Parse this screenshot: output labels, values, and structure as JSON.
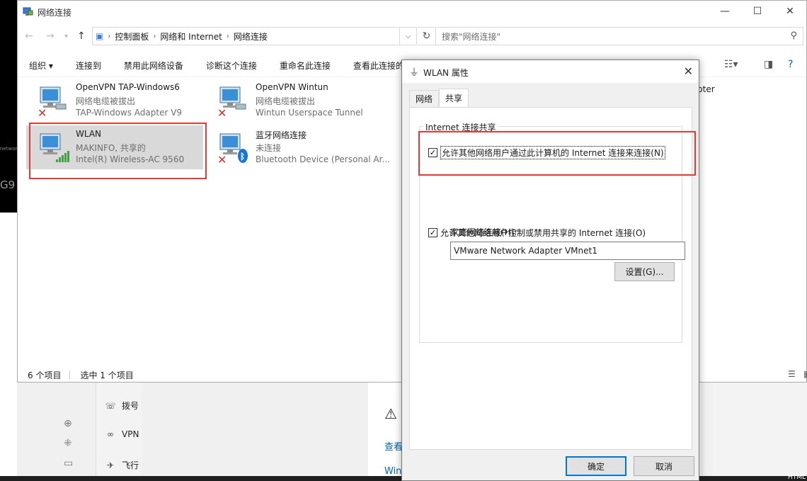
{
  "background": {
    "g9_text": "G9",
    "net_text": "network",
    "settings_items": [
      {
        "label": "拨号",
        "icon": "dialup-icon"
      },
      {
        "label": "VPN",
        "icon": "vpn-icon"
      },
      {
        "label": "飞行",
        "icon": "airplane-icon"
      }
    ],
    "links": [
      "查看",
      "Win"
    ],
    "html_label": "HTML"
  },
  "explorer": {
    "title": "网络连接",
    "breadcrumb": [
      "控制面板",
      "网络和 Internet",
      "网络连接"
    ],
    "search_placeholder": "搜索\"网络连接\"",
    "commands": [
      "组织 ▾",
      "连接到",
      "禁用此网络设备",
      "诊断这个连接",
      "重命名此连接",
      "查看此连接的状"
    ],
    "items": [
      {
        "name": "OpenVPN TAP-Windows6",
        "status": "网络电缆被拔出",
        "device": "TAP-Windows Adapter V9",
        "icon": "network-adapter-icon"
      },
      {
        "name": "OpenVPN Wintun",
        "status": "网络电缆被拔出",
        "device": "Wintun Userspace Tunnel",
        "icon": "network-adapter-icon"
      },
      {
        "name": "WLAN",
        "status": "MAKINFO, 共享的",
        "device": "Intel(R) Wireless-AC 9560",
        "icon": "wifi-adapter-icon"
      },
      {
        "name": "蓝牙网络连接",
        "status": "未连接",
        "device": "Bluetooth Device (Personal Ar...",
        "icon": "bluetooth-adapter-icon"
      }
    ],
    "partial_item": "pter",
    "status_count": "6 个项目",
    "status_selected": "选中 1 个项目"
  },
  "dialog": {
    "title": "WLAN 属性",
    "tabs": [
      "网络",
      "共享"
    ],
    "group_label": "Internet 连接共享",
    "allow_share": "允许其他网络用户通过此计算机的 Internet 连接来连接(N)",
    "home_label": "家庭网络连接(H):",
    "home_value": "VMware Network Adapter VMnet1",
    "allow_control": "允许其他网络用户控制或禁用共享的 Internet 连接(O)",
    "settings_button": "设置(G)...",
    "ok_button": "确定",
    "cancel_button": "取消"
  },
  "colors": {
    "accent": "#0078d7",
    "highlight_box": "#e53935",
    "link": "#0063b1"
  }
}
